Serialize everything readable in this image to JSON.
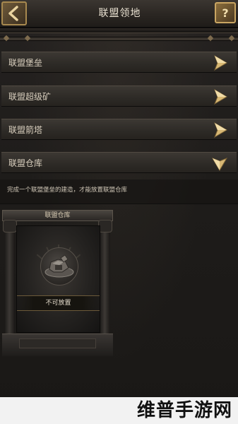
{
  "header": {
    "title": "联盟领地",
    "help_label": "?"
  },
  "menu": {
    "items": [
      {
        "label": "联盟堡垒",
        "state": "collapsed"
      },
      {
        "label": "联盟超级矿",
        "state": "collapsed"
      },
      {
        "label": "联盟箭塔",
        "state": "collapsed"
      },
      {
        "label": "联盟仓库",
        "state": "expanded"
      }
    ]
  },
  "expanded": {
    "description": "完成一个联盟堡垒的建造，才能放置联盟仓库",
    "card": {
      "title": "联盟仓库",
      "status": "不可放置"
    }
  },
  "watermark": {
    "text": "维普手游网"
  },
  "colors": {
    "gold": "#c9a562",
    "text": "#d9cfbe",
    "background": "#1e1c1a"
  }
}
